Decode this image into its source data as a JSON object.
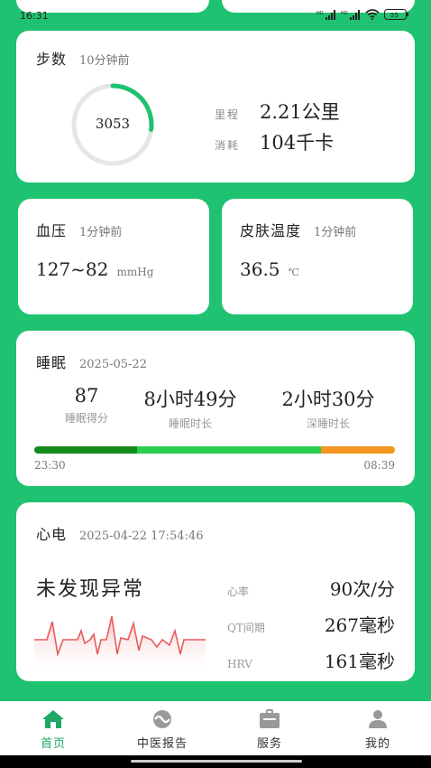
{
  "status_bar": {
    "time": "16:31"
  },
  "steps": {
    "title": "步数",
    "time_ago": "10分钟前",
    "count": "3053",
    "progress": 0.27,
    "distance_label": "里程",
    "distance_value": "2.21公里",
    "calories_label": "消耗",
    "calories_value": "104千卡"
  },
  "blood_pressure": {
    "title": "血压",
    "time_ago": "1分钟前",
    "value": "127~82",
    "unit": "mmHg"
  },
  "skin_temp": {
    "title": "皮肤温度",
    "time_ago": "1分钟前",
    "value": "36.5",
    "unit": "℃"
  },
  "sleep": {
    "title": "睡眠",
    "date": "2025-05-22",
    "score": "87",
    "score_label": "睡眠得分",
    "duration": "8小时49分",
    "duration_label": "睡眠时长",
    "deep": "2小时30分",
    "deep_label": "深睡时长",
    "start_time": "23:30",
    "end_time": "08:39",
    "segments": [
      {
        "name": "dark",
        "fraction": 0.285,
        "color": "#138a1c"
      },
      {
        "name": "light",
        "fraction": 0.51,
        "color": "#2ccd52"
      },
      {
        "name": "awake",
        "fraction": 0.205,
        "color": "#f2961f"
      }
    ]
  },
  "ecg": {
    "title": "心电",
    "datetime": "2025-04-22 17:54:46",
    "result": "未发现异常",
    "hr_label": "心率",
    "hr_value": "90次/分",
    "qt_label": "QT间期",
    "qt_value": "267毫秒",
    "hrv_label": "HRV",
    "hrv_value": "161毫秒"
  },
  "nav": {
    "home": "首页",
    "report": "中医报告",
    "service": "服务",
    "mine": "我的"
  },
  "colors": {
    "background": "#1fc270",
    "accent": "#1fa765",
    "ecg_line": "#e85b5b"
  }
}
